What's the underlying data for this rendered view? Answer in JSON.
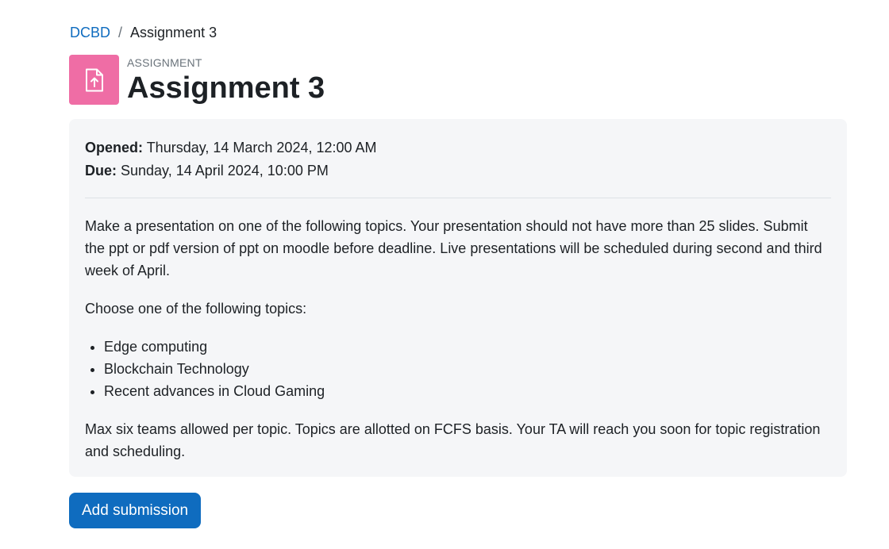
{
  "breadcrumb": {
    "course_link": "DCBD",
    "separator": "/",
    "current": "Assignment 3"
  },
  "header": {
    "icon": "file-upload-icon",
    "icon_color": "#ef6da5",
    "activity_type": "ASSIGNMENT",
    "title": "Assignment 3"
  },
  "dates": {
    "opened_label": "Opened:",
    "opened_value": " Thursday, 14 March 2024, 12:00 AM",
    "due_label": "Due:",
    "due_value": " Sunday, 14 April 2024, 10:00 PM"
  },
  "description": {
    "intro": "Make a presentation on one of the following topics. Your presentation should not have more than 25 slides. Submit the ppt or pdf version of ppt on moodle before deadline. Live presentations will be scheduled during second and third week of April.",
    "choose": "Choose one of the following topics:",
    "topics": [
      "Edge computing",
      "Blockchain Technology",
      "Recent advances in Cloud Gaming"
    ],
    "note": "Max six teams allowed per topic. Topics are allotted on FCFS basis. Your TA will reach you soon for topic registration and scheduling."
  },
  "actions": {
    "add_submission_label": "Add submission",
    "accent_color": "#0f6cbf"
  }
}
